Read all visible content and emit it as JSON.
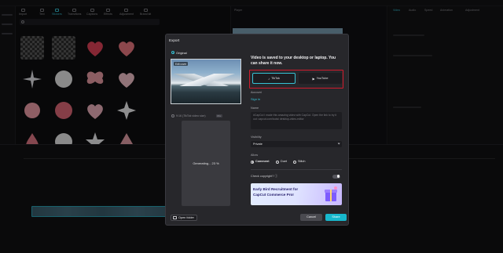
{
  "background": {
    "media_tabs": [
      "Import",
      "Text",
      "Stickers",
      "Transitions",
      "Captions",
      "Effects",
      "Adjustment",
      "Brand kit"
    ],
    "active_media_tab_index": 2,
    "player_label": "Player",
    "right_panel_tabs": [
      "Video",
      "Audio",
      "Speed",
      "Animation",
      "Adjustment"
    ]
  },
  "dialog": {
    "title": "Export",
    "original": {
      "label": "Original",
      "cover_label": "Edit cover"
    },
    "generated": {
      "label": "9:16 (TikTok video size)",
      "badge": "Pro",
      "progress_text": "Generating... 23 %"
    },
    "message": "Video is saved to your desktop or laptop. You can share it now.",
    "platforms": [
      {
        "label": "TikTok",
        "icon": "tiktok-icon",
        "selected": true
      },
      {
        "label": "YouTube",
        "icon": "youtube-icon",
        "selected": false
      }
    ],
    "account": {
      "label": "Account",
      "sign_in": "Sign in"
    },
    "name": {
      "label": "Name",
      "placeholder": "#CapCut I made this amazing video with CapCut. Open the link to try it out: capcut.com/tools/ desktop-video-editor"
    },
    "visibility": {
      "label": "Visibility",
      "value": "Private"
    },
    "allow": {
      "label": "Allow",
      "options": [
        {
          "label": "Comment",
          "checked": true
        },
        {
          "label": "Duet",
          "checked": false
        },
        {
          "label": "Stitch",
          "checked": false
        }
      ]
    },
    "copyright": {
      "label": "Check copyright? ⓘ",
      "enabled": true
    },
    "banner": {
      "line1": "Early Bird Recruitment for",
      "line2": "CapCut Commerce Pro!"
    },
    "buttons": {
      "open_folder": "Open folder",
      "cancel": "Cancel",
      "share": "Share"
    },
    "colors": {
      "accent": "#17b8cd",
      "highlight_frame": "#d11b2c"
    }
  }
}
